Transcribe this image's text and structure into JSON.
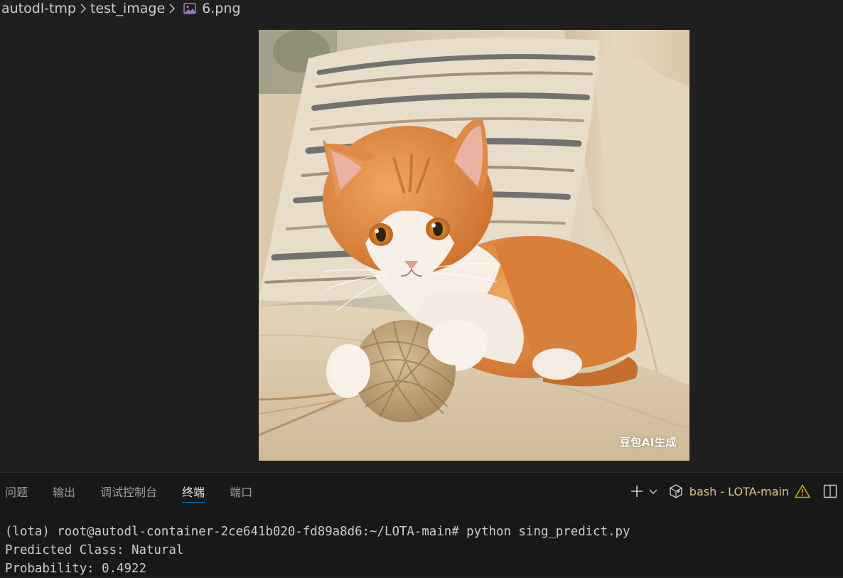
{
  "breadcrumb": {
    "items": [
      "autodl-tmp",
      "test_image"
    ],
    "file": "6.png"
  },
  "image": {
    "description_icon": "image-file-icon",
    "watermark": "豆包AI生成"
  },
  "panel": {
    "tabs": [
      {
        "label": "问题",
        "active": false
      },
      {
        "label": "输出",
        "active": false
      },
      {
        "label": "调试控制台",
        "active": false
      },
      {
        "label": "终端",
        "active": true
      },
      {
        "label": "端口",
        "active": false
      }
    ],
    "terminal_name": "bash - LOTA-main",
    "icons": [
      "plus-icon",
      "chevron-down-icon",
      "terminal-profile-icon",
      "warning-icon",
      "split-panel-icon"
    ]
  },
  "terminal": {
    "lines": [
      "(lota) root@autodl-container-2ce641b020-fd89a8d6:~/LOTA-main# python sing_predict.py",
      "Predicted Class: Natural",
      "Probability: 0.4922"
    ]
  },
  "colors": {
    "background": "#1f1f1f",
    "panel_background": "#181818",
    "active_tab_underline": "#0078d4",
    "terminal_name": "#e2c08d",
    "warning": "#cca700",
    "file_icon": "#a074c4"
  }
}
